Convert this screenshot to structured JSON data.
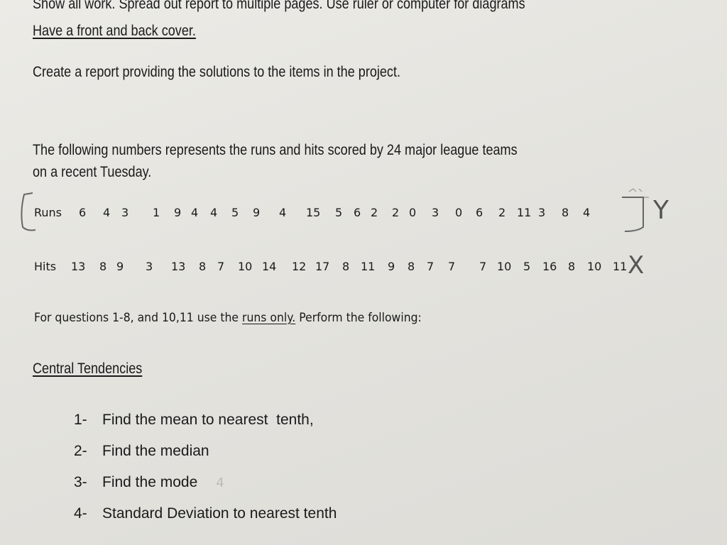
{
  "instructions": {
    "line1": "Show all work. Spread out report to multiple pages. Use ruler or computer for diagrams",
    "line2": "Have a front and back cover.",
    "line3": "Create a report providing the solutions to the items in the project."
  },
  "intro": {
    "line1": "The following numbers represents the runs and hits scored by 24 major league teams",
    "line2": "on a recent Tuesday."
  },
  "runs": {
    "label": "Runs",
    "values": [
      "6",
      "4",
      "3",
      "1",
      "9",
      "4",
      "4",
      "5",
      "9",
      "4",
      "15",
      "5",
      "6",
      "2",
      "2",
      "0",
      "3",
      "0",
      "6",
      "2",
      "11",
      "3",
      "8",
      "4"
    ],
    "annotation": "Y"
  },
  "hits": {
    "label": "Hits",
    "values": [
      "13",
      "8",
      "9",
      "3",
      "13",
      "8",
      "7",
      "10",
      "14",
      "12",
      "17",
      "8",
      "11",
      "9",
      "8",
      "7",
      "7",
      "7",
      "10",
      "5",
      "16",
      "8",
      "10",
      "11"
    ],
    "annotation": "X"
  },
  "directions": {
    "before": "For questions 1-8, and 10,11 use the ",
    "emphasis": "runs only.",
    "after": " Perform the following:"
  },
  "section": {
    "title": "Central Tendencies"
  },
  "questions": [
    {
      "num": "1-",
      "text": "Find the mean to nearest  tenth,"
    },
    {
      "num": "2-",
      "text": "Find the median"
    },
    {
      "num": "3-",
      "text": "Find the mode",
      "note": "4"
    },
    {
      "num": "4-",
      "text": "Standard Deviation to nearest tenth"
    }
  ]
}
